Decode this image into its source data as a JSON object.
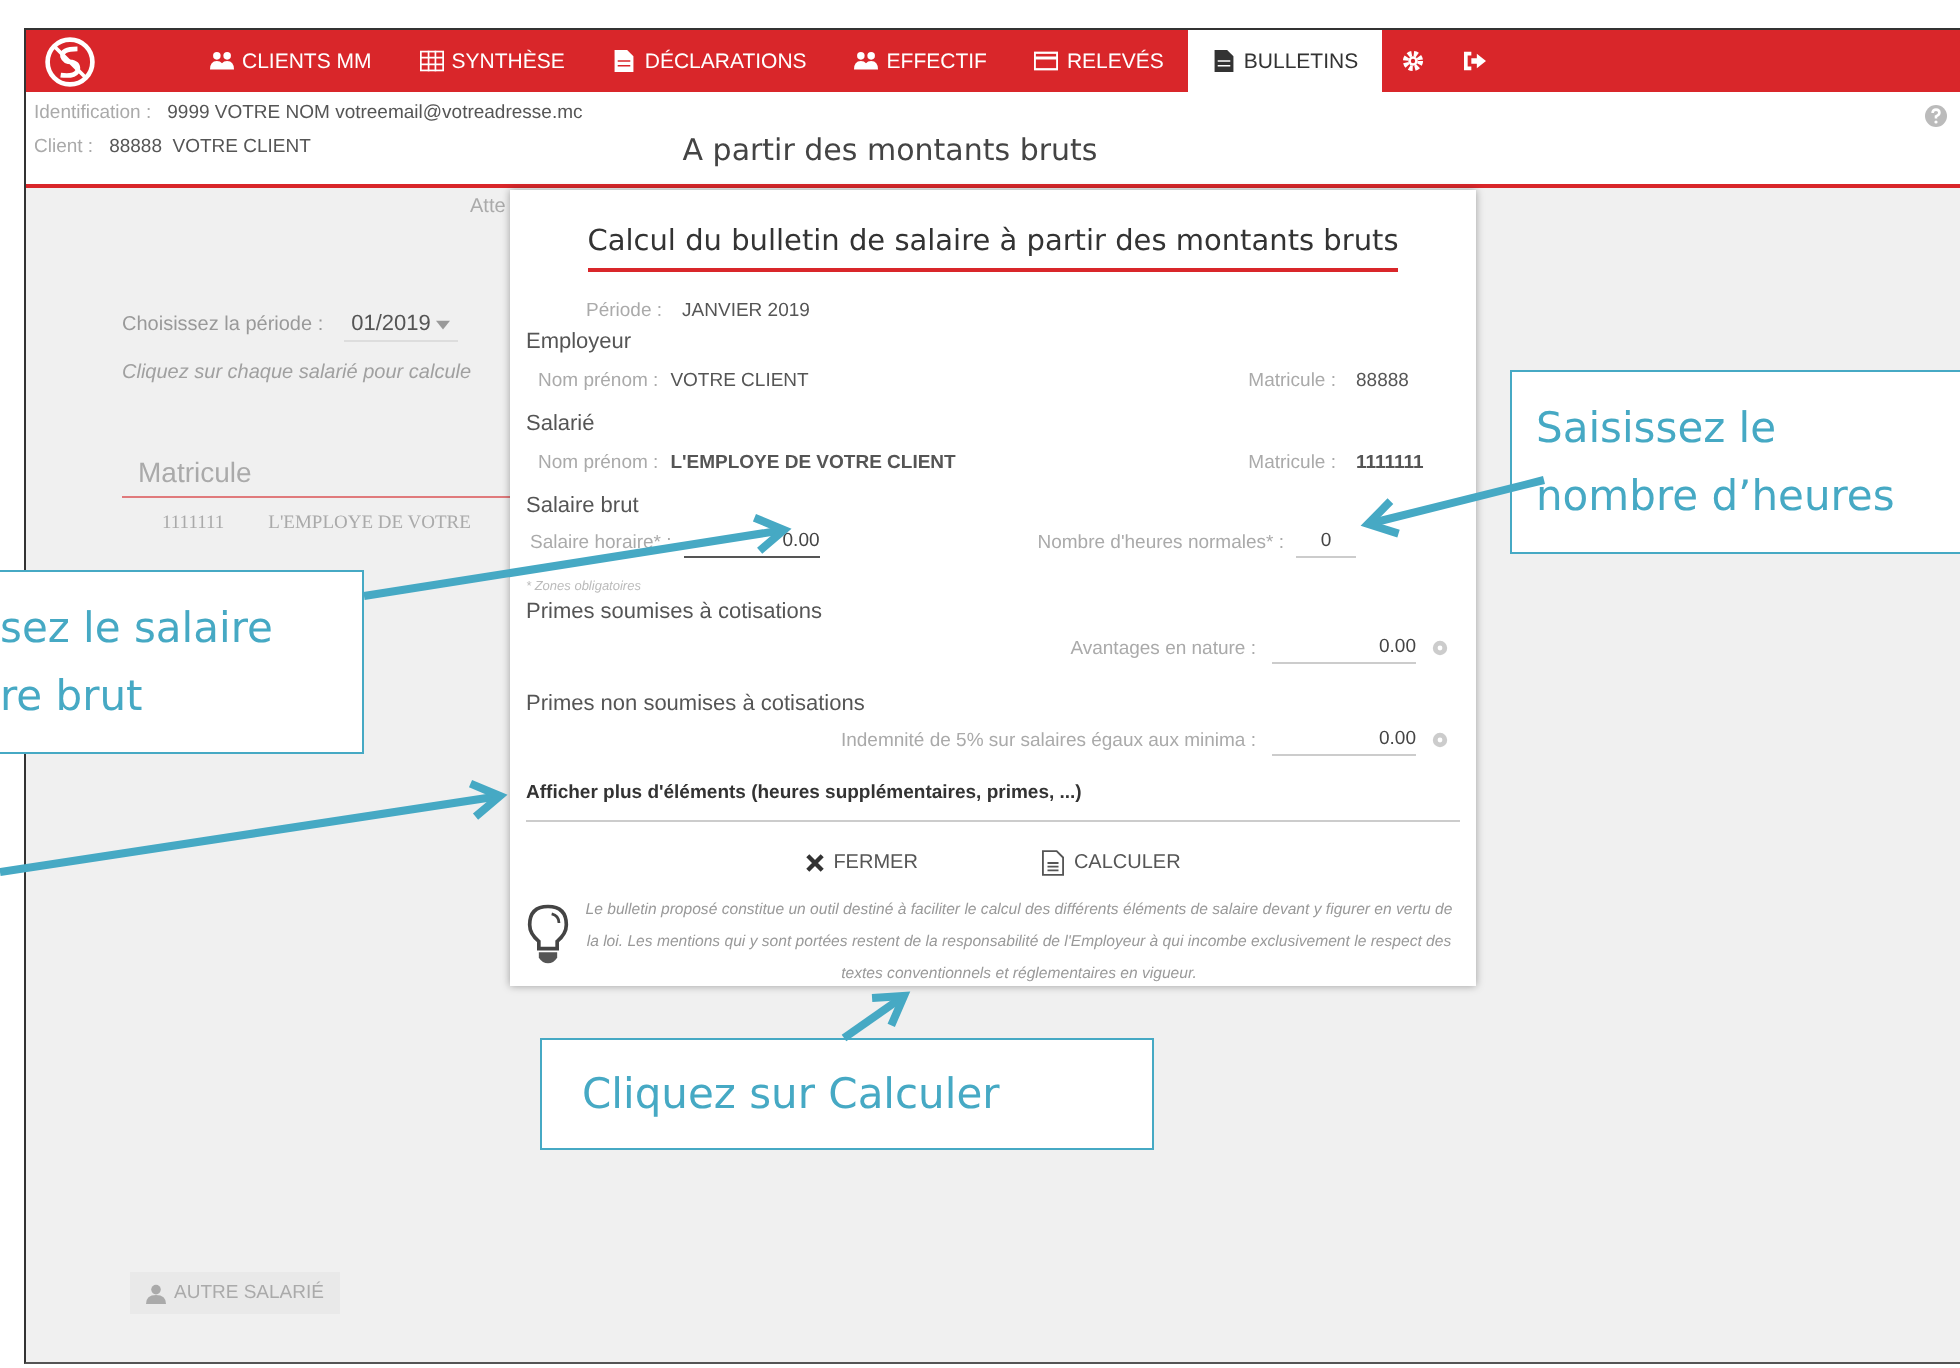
{
  "nav": {
    "items": [
      {
        "label": "CLIENTS MM",
        "kind": "users",
        "selected": false
      },
      {
        "label": "SYNTHÈSE",
        "kind": "table",
        "selected": false
      },
      {
        "label": "DÉCLARATIONS",
        "kind": "file",
        "selected": false
      },
      {
        "label": "EFFECTIF",
        "kind": "users",
        "selected": false
      },
      {
        "label": "RELEVÉS",
        "kind": "card",
        "selected": false
      },
      {
        "label": "BULLETINS",
        "kind": "file",
        "selected": true
      }
    ]
  },
  "info": {
    "identification_label": "Identification :",
    "identification_value": "9999 VOTRE NOM votreemail@votreadresse.mc",
    "client_label": "Client :",
    "client_value": "88888  VOTRE CLIENT"
  },
  "page_title": "A partir des montants bruts",
  "background": {
    "partial_text": "Atte",
    "period_label": "Choisissez la période :",
    "period_value": "01/2019",
    "hint": "Cliquez sur chaque salarié pour calcule",
    "column": "Matricule",
    "row": [
      "1111111",
      "L'EMPLOYE DE VOTRE"
    ],
    "button": "AUTRE SALARIÉ"
  },
  "modal": {
    "title": "Calcul du bulletin de salaire à partir des montants bruts",
    "period_label": "Période :",
    "period_value": "JANVIER 2019",
    "parties": [
      {
        "heading": "Employeur",
        "name_label": "Nom prénom :",
        "name": "VOTRE CLIENT",
        "matricule_label": "Matricule :",
        "matricule": "88888",
        "bold": false
      },
      {
        "heading": "Salarié",
        "name_label": "Nom prénom :",
        "name": "L'EMPLOYE DE VOTRE CLIENT",
        "matricule_label": "Matricule :",
        "matricule": "1111111",
        "bold": true
      }
    ],
    "salary_heading": "Salaire brut",
    "hourly_label": "Salaire horaire* :",
    "hourly_value": "0.00",
    "hours_label": "Nombre d'heures normales* :",
    "hours_value": "0",
    "required_note": "* Zones obligatoires",
    "groups": [
      {
        "heading": "Primes soumises à cotisations",
        "label": "Avantages en nature :",
        "value": "0.00"
      },
      {
        "heading": "Primes non soumises à cotisations",
        "label": "Indemnité de 5% sur salaires égaux aux minima :",
        "value": "0.00"
      }
    ],
    "more_link": "Afficher plus d'éléments (heures supplémentaires, primes, ...)",
    "buttons": [
      {
        "label": "FERMER",
        "kind": "close"
      },
      {
        "label": "CALCULER",
        "kind": "calculate"
      }
    ],
    "disclaimer": "Le bulletin proposé constitue un outil destiné à faciliter le calcul des différents éléments de salaire devant y figurer en vertu de la loi. Les mentions qui y sont portées restent de la responsabilité de l'Employeur à qui incombe exclusivement le respect des textes conventionnels et réglementaires en vigueur."
  },
  "callouts": [
    {
      "lines": [
        "sez le salaire",
        "re brut"
      ]
    },
    {
      "lines": [
        "Saisissez le",
        "nombre d’heures"
      ]
    },
    {
      "lines": [
        "Cliquez sur Calculer"
      ]
    }
  ]
}
